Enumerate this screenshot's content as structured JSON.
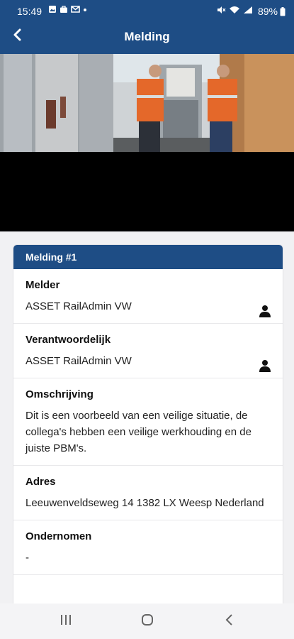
{
  "status_bar": {
    "time": "15:49",
    "battery": "89%",
    "icons": [
      "gallery-icon",
      "bag-icon",
      "gmail-icon",
      "dot-icon",
      "mute-icon",
      "wifi-icon",
      "signal-icon",
      "battery-icon"
    ]
  },
  "header": {
    "back_icon": "back-arrow-icon",
    "title": "Melding"
  },
  "card": {
    "title": "Melding #1",
    "fields": [
      {
        "label": "Melder",
        "value": "ASSET RailAdmin VW",
        "icon": "person-icon"
      },
      {
        "label": "Verantwoordelijk",
        "value": "ASSET RailAdmin VW",
        "icon": "person-icon"
      },
      {
        "label": "Omschrijving",
        "value": "Dit is een voorbeeld van een veilige situatie, de collega's hebben een veilige werkhouding en de juiste PBM's."
      },
      {
        "label": "Adres",
        "value": "Leeuwenveldseweg 14 1382 LX Weesp Nederland"
      },
      {
        "label": "Ondernomen",
        "value": "-"
      }
    ]
  },
  "nav": {
    "recent_icon": "recent-apps-icon",
    "home_icon": "home-icon",
    "back_icon": "nav-back-icon"
  },
  "colors": {
    "brand": "#1e4d85",
    "background": "#f1f1f3"
  }
}
